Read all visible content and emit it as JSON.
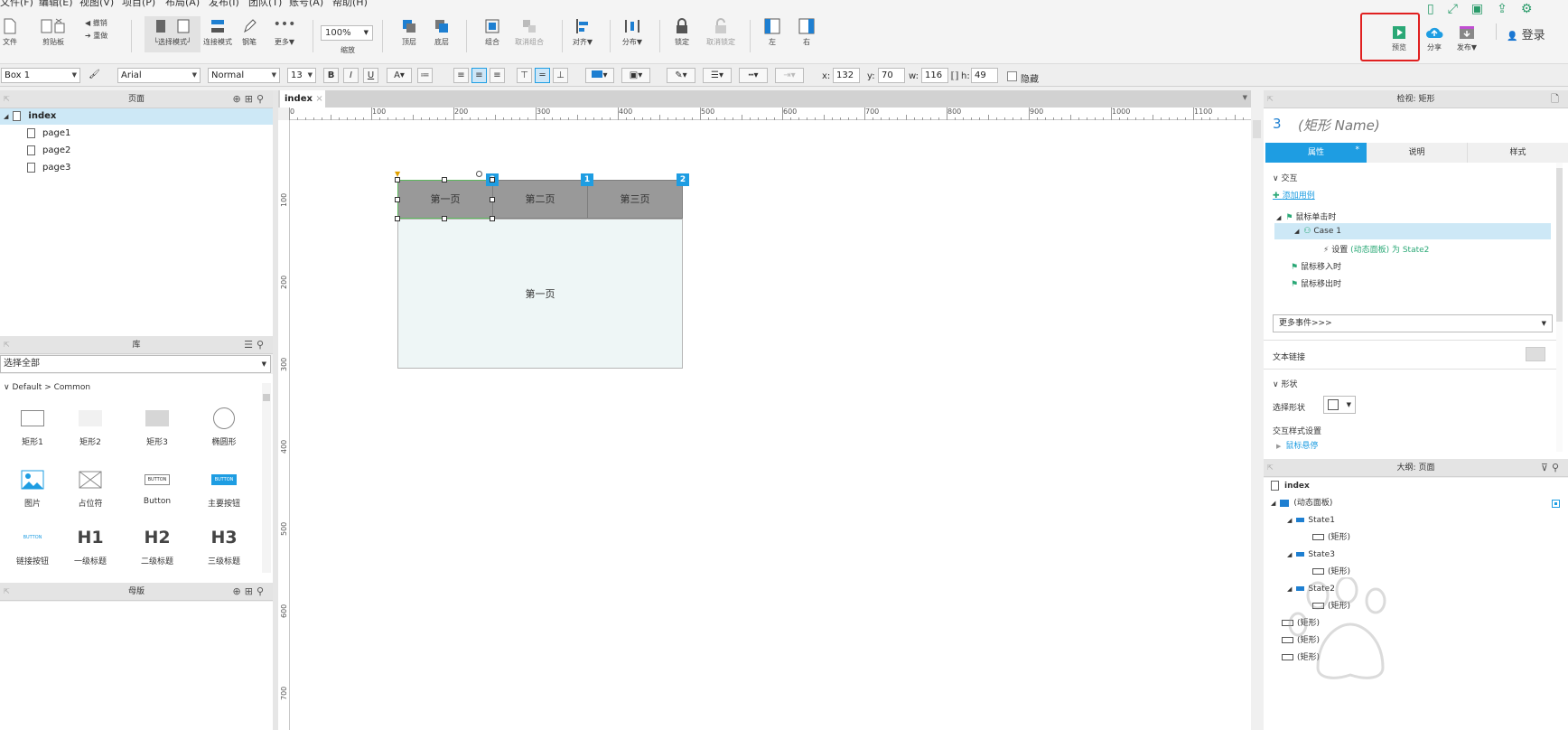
{
  "menu": [
    "文件(F)",
    "编辑(E)",
    "视图(V)",
    "项目(P)",
    "布局(A)",
    "发布(I)",
    "团队(T)",
    "账号(A)",
    "帮助(H)"
  ],
  "toolbar": {
    "file": "文件",
    "clipboard": "剪贴板",
    "undo": "撤销",
    "redo": "重做",
    "select_mode": "└选择模式┘",
    "connect_mode": "连接模式",
    "pen": "钢笔",
    "more": "更多▼",
    "zoom_value": "100%",
    "zoom_label": "缩放",
    "top_layer": "顶层",
    "bottom_layer": "底层",
    "group": "组合",
    "ungroup": "取消组合",
    "align": "对齐▼",
    "distribute": "分布▼",
    "lock": "锁定",
    "unlock": "取消锁定",
    "left": "左",
    "right": "右",
    "preview": "预览",
    "share": "分享",
    "publish": "发布▼",
    "login": "登录"
  },
  "format": {
    "style": "Box 1",
    "font": "Arial",
    "weight": "Normal",
    "size": "13",
    "x_label": "x:",
    "x": "132",
    "y_label": "y:",
    "y": "70",
    "w_label": "w:",
    "w": "116",
    "h_label": "h:",
    "h": "49",
    "hidden_label": "隐藏"
  },
  "pages_panel": {
    "title": "页面",
    "items": [
      "index",
      "page1",
      "page2",
      "page3"
    ]
  },
  "library": {
    "title": "库",
    "select_all": "选择全部",
    "group": "Default > Common",
    "widgets": [
      "矩形1",
      "矩形2",
      "矩形3",
      "椭圆形",
      "图片",
      "占位符",
      "Button",
      "主要按钮",
      "链接按钮",
      "一级标题",
      "二级标题",
      "三级标题"
    ],
    "btn_text": "BUTTON",
    "h1": "H1",
    "h2": "H2",
    "h3": "H3"
  },
  "masters": {
    "title": "母版"
  },
  "canvas": {
    "tab": "index",
    "ruler_h": [
      "0",
      "100",
      "200",
      "300",
      "400",
      "500",
      "600",
      "700",
      "800",
      "900",
      "1000",
      "1100"
    ],
    "ruler_v": [
      "100",
      "200",
      "300",
      "400",
      "500",
      "600",
      "700"
    ],
    "tabs": [
      "第一页",
      "第二页",
      "第三页"
    ],
    "badges": [
      "3",
      "1",
      "2"
    ],
    "content": "第一页"
  },
  "inspector": {
    "header": "检视: 矩形",
    "id": "3",
    "name_placeholder": "(矩形 Name)",
    "tabs": [
      "属性",
      "说明",
      "样式"
    ],
    "interaction": "交互",
    "add_case": "添加用例",
    "on_click": "鼠标单击时",
    "case1": "Case 1",
    "action_set": "设置",
    "action_target": "(动态面板) 为 State2",
    "on_enter": "鼠标移入时",
    "on_leave": "鼠标移出时",
    "more_events": "更多事件>>>",
    "text_link": "文本链接",
    "shape": "形状",
    "select_shape": "选择形状",
    "interaction_style": "交互样式设置",
    "hover": "鼠标悬停"
  },
  "outline": {
    "title": "大纲: 页面",
    "root": "index",
    "panel": "(动态面板)",
    "state1": "State1",
    "state3": "State3",
    "state2": "State2",
    "rect": "(矩形)",
    "rect_short": "(矩形)",
    "paren_rect_a": "(矩形)",
    "paren_rect_b": "(矩形)",
    "paren_rect_c": "(矩形)"
  },
  "colors": {
    "accent": "#1e9de2",
    "highlight_border": "#e02020",
    "tab_gray": "#999999",
    "panel_fill": "#eef6f6",
    "green_select": "#5cb85c"
  }
}
